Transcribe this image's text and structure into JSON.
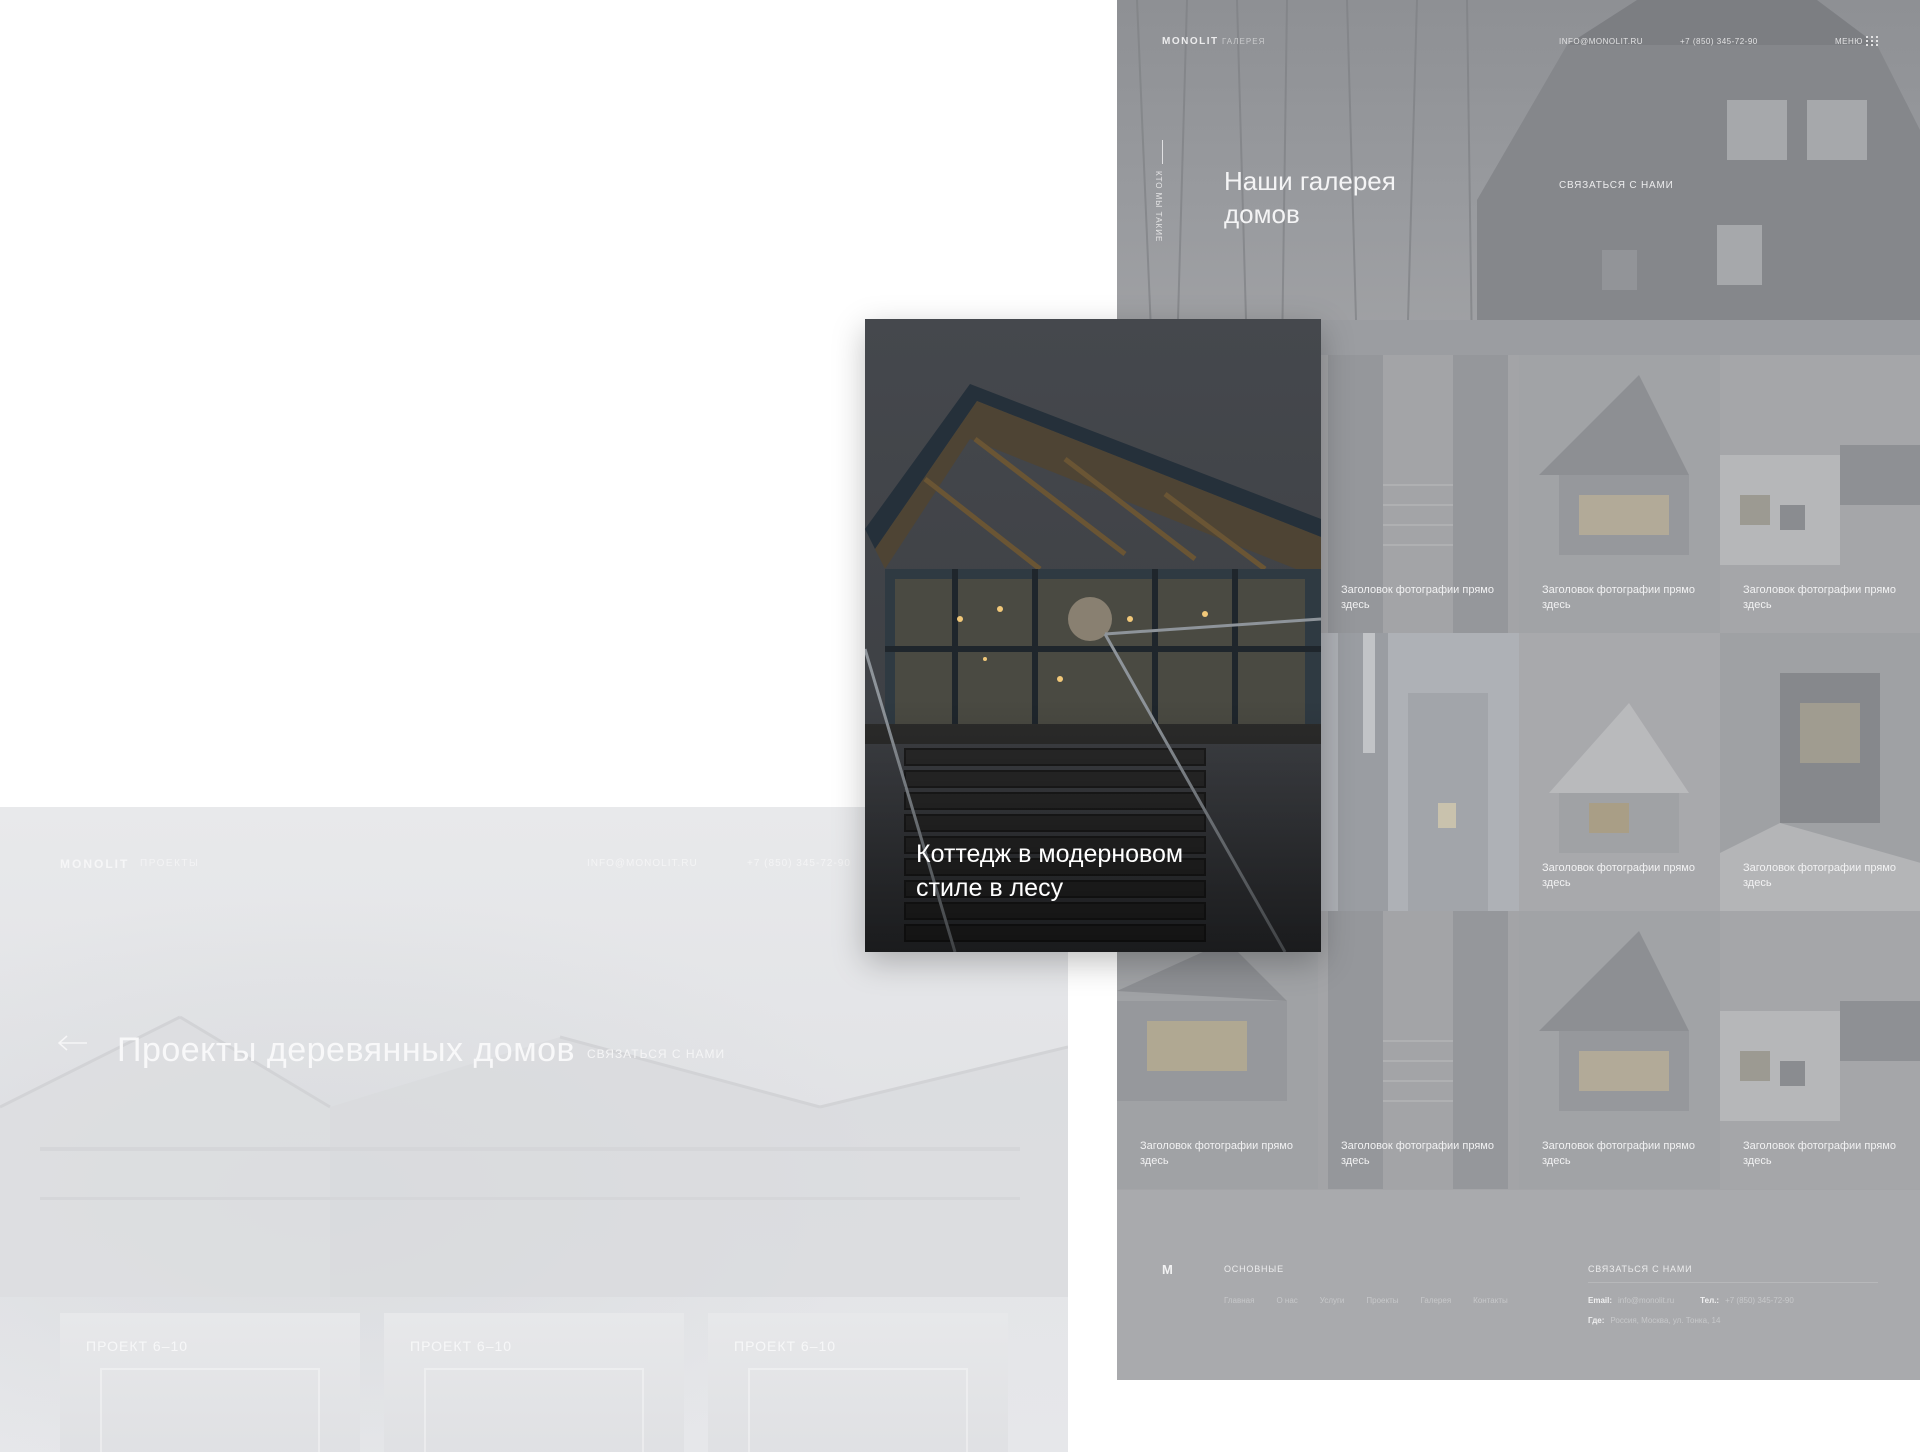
{
  "left_page": {
    "logo": "MONOLIT",
    "logo_sub": "ПРОЕКТЫ",
    "email": "INFO@MONOLIT.RU",
    "phone": "+7 (850) 345-72-90",
    "title": "Проекты деревянных домов",
    "contact_label": "СВЯЗАТЬСЯ С НАМИ",
    "cards": [
      {
        "label": "ПРОЕКТ 6–10"
      },
      {
        "label": "ПРОЕКТ 6–10"
      },
      {
        "label": "ПРОЕКТ 6–10"
      }
    ]
  },
  "right_page": {
    "nav": {
      "logo": "MONOLIT",
      "section": "ГАЛЕРЕЯ",
      "email": "INFO@MONOLIT.RU",
      "phone": "+7 (850) 345-72-90",
      "menu": "МЕНЮ"
    },
    "vertical_label": "КТО МЫ ТАКИЕ",
    "hero_title": "Наши галерея домов",
    "hero_contact": "СВЯЗАТЬСЯ С НАМИ",
    "tiles": [
      {
        "caption": ""
      },
      {
        "caption": "Заголовок фотографии прямо здесь"
      },
      {
        "caption": "Заголовок фотографии прямо здесь"
      },
      {
        "caption": "Заголовок фотографии прямо здесь"
      },
      {
        "caption": ""
      },
      {
        "caption": ""
      },
      {
        "caption": "Заголовок фотографии прямо здесь"
      },
      {
        "caption": "Заголовок фотографии прямо здесь"
      },
      {
        "caption": "Заголовок фотографии прямо здесь"
      },
      {
        "caption": "Заголовок фотографии прямо здесь"
      },
      {
        "caption": "Заголовок фотографии прямо здесь"
      },
      {
        "caption": "Заголовок фотографии прямо здесь"
      }
    ],
    "footer": {
      "logo": "M",
      "heading": "ОСНОВНЫЕ",
      "links": [
        "Главная",
        "О нас",
        "Услуги",
        "Проекты",
        "Галерея",
        "Контакты"
      ],
      "contact_heading": "СВЯЗАТЬСЯ С НАМИ",
      "email_label": "Email:",
      "email_value": "info@monolit.ru",
      "phone_label": "Тел.:",
      "phone_value": "+7 (850) 345-72-90",
      "address_label": "Где:",
      "address_value": "Россия, Москва, ул. Тонка, 14"
    }
  },
  "featured": {
    "title": "Коттедж в модерновом стиле в лесу"
  }
}
